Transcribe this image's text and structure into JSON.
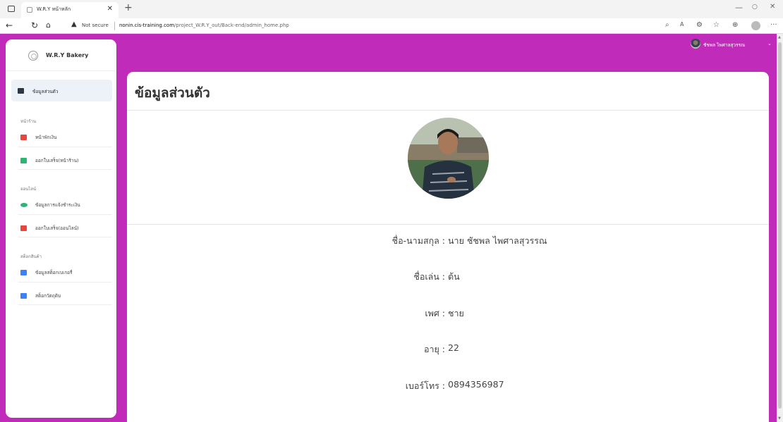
{
  "browser": {
    "tab_title": "W.R.Y หน้าหลัก",
    "not_secure": "Not secure",
    "url_host": "nonin.cis-training.com",
    "url_path": "/project_W.R.Y_out/Back-end/admin_home.php"
  },
  "sidebar": {
    "brand": "W.R.Y Bakery",
    "active_item": "ข้อมูลส่วนตัว",
    "sections": [
      {
        "heading": "หน้าร้าน",
        "items": [
          "หน้าพักเงิน",
          "ออกใบเสร็จ(หน้าร้าน)"
        ]
      },
      {
        "heading": "ออนไลน์",
        "items": [
          "ข้อมูลการแจ้งชำระเงิน",
          "ออกใบเสร็จ(ออนไลน์)"
        ]
      },
      {
        "heading": "สต็อกสินค้า",
        "items": [
          "ข้อมูลสต็อกเบเกอรี่",
          "สต็อกวัตถุดิบ"
        ]
      }
    ]
  },
  "topbar": {
    "user_name": "ชัชพล ไพศาลสุวรรณ"
  },
  "profile": {
    "title": "ข้อมูลส่วนตัว",
    "fields": [
      {
        "label": "ชื่อ-นามสกุล :",
        "value": "นาย ชัชพล ไพศาลสุวรรณ"
      },
      {
        "label": "ชื่อเล่น :",
        "value": "ต้น"
      },
      {
        "label": "เพศ :",
        "value": "ชาย"
      },
      {
        "label": "อายุ :",
        "value": "22"
      },
      {
        "label": "เบอร์โทร :",
        "value": "0894356987"
      }
    ]
  },
  "colors": {
    "page_background": "#c12bba",
    "icon_red": "#e8453c",
    "icon_green": "#2bb673",
    "icon_blue": "#3b82f6",
    "icon_dark": "#2d3748"
  },
  "icons": {
    "active_item": "id-card-icon",
    "items": [
      "book-red-icon",
      "book-green-icon",
      "users-icon",
      "book-red-icon",
      "sitemap-icon",
      "book-blue-icon"
    ]
  }
}
